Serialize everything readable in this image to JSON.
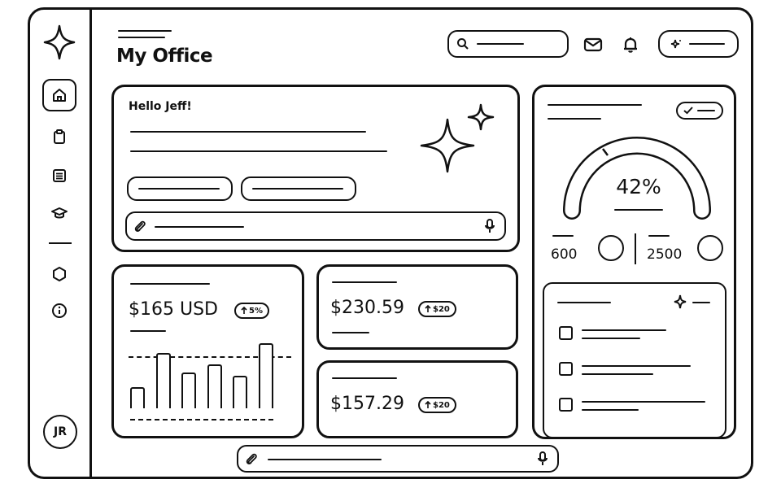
{
  "sidebar": {
    "logo_icon": "sparkle-icon",
    "items": [
      {
        "icon": "home-icon",
        "active": true
      },
      {
        "icon": "clipboard-icon",
        "active": false
      },
      {
        "icon": "list-icon",
        "active": false
      },
      {
        "icon": "graduation-cap-icon",
        "active": false
      },
      {
        "icon": "hexagon-icon",
        "active": false
      },
      {
        "icon": "info-icon",
        "active": false
      }
    ],
    "avatar_initials": "JR"
  },
  "header": {
    "title": "My Office",
    "icons": [
      "search-icon",
      "mail-icon",
      "bell-icon",
      "sparkle-icon"
    ]
  },
  "welcome_card": {
    "greeting": "Hello Jeff!",
    "prompt_icons": [
      "paperclip-icon",
      "microphone-icon"
    ]
  },
  "metrics": [
    {
      "amount": "$165 USD",
      "change": "5%",
      "change_icon": "arrow-up-icon",
      "bars": [
        0.33,
        0.85,
        0.55,
        0.68,
        0.5,
        1.0
      ]
    },
    {
      "amount": "$230.59",
      "change": "$20",
      "change_icon": "arrow-up-icon"
    },
    {
      "amount": "$157.29",
      "change": "$20",
      "change_icon": "arrow-up-icon"
    }
  ],
  "progress_card": {
    "gauge_percent": "42%",
    "gauge_fraction": 0.42,
    "stats": [
      {
        "value": "600"
      },
      {
        "value": "2500"
      }
    ],
    "tasks": [
      {
        "checked": false
      },
      {
        "checked": false
      },
      {
        "checked": false
      }
    ]
  },
  "bottom_prompt": {
    "icons": [
      "paperclip-icon",
      "microphone-icon"
    ]
  }
}
